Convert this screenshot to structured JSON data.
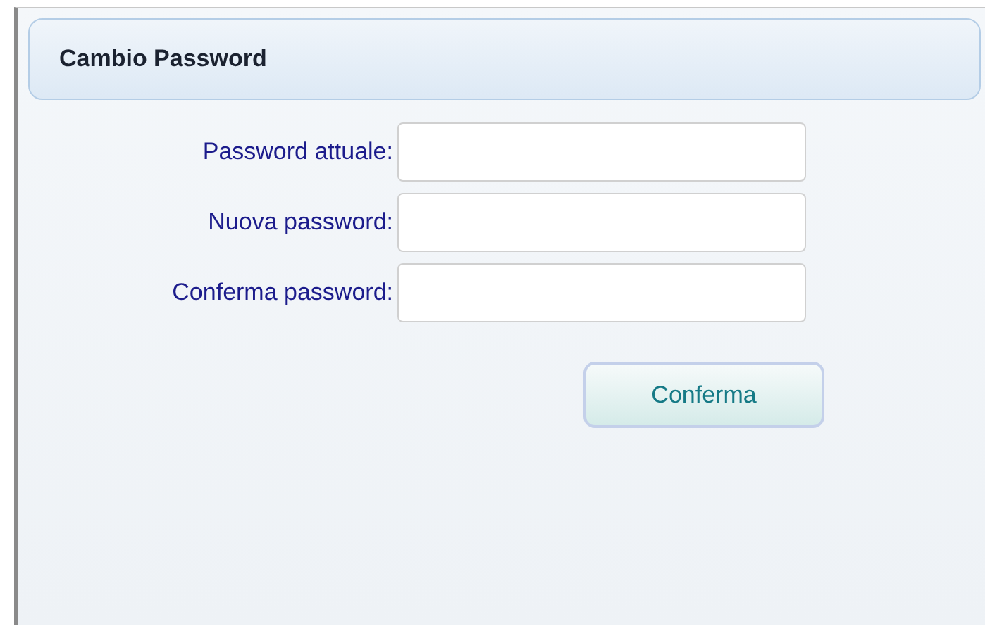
{
  "panel": {
    "title": "Cambio Password"
  },
  "fields": [
    {
      "label": "Password attuale:"
    },
    {
      "label": "Nuova password:"
    },
    {
      "label": "Conferma password:"
    }
  ],
  "button": {
    "label": "Conferma"
  }
}
